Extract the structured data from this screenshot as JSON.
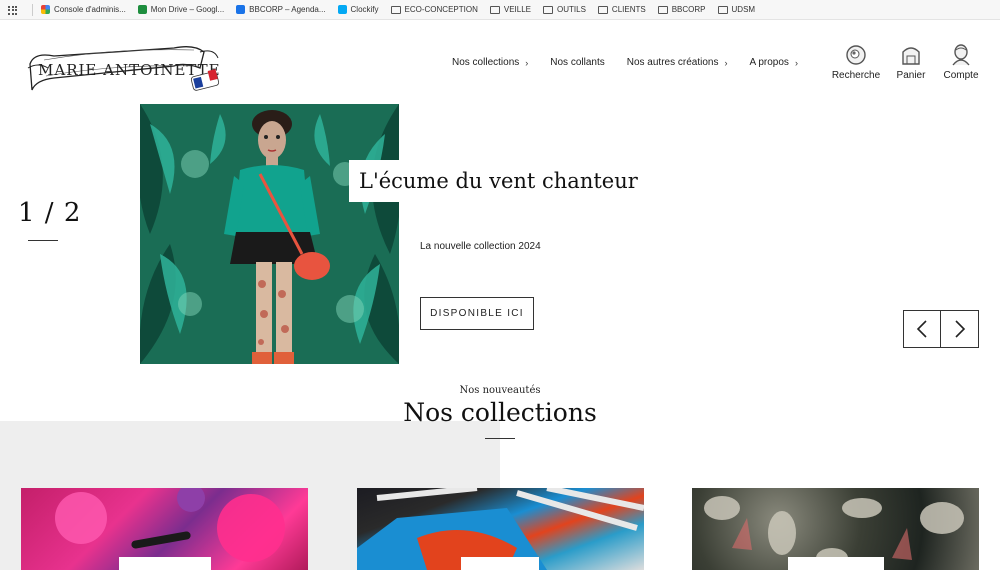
{
  "bookmarks": [
    {
      "label": "Console d'adminis...",
      "icon": "google-icon"
    },
    {
      "label": "Mon Drive – Googl...",
      "icon": "drive-icon"
    },
    {
      "label": "BBCORP – Agenda...",
      "icon": "calendar-icon"
    },
    {
      "label": "Clockify",
      "icon": "clockify-icon"
    },
    {
      "label": "ECO-CONCEPTION",
      "icon": "folder-icon"
    },
    {
      "label": "VEILLE",
      "icon": "folder-icon"
    },
    {
      "label": "OUTILS",
      "icon": "folder-icon"
    },
    {
      "label": "CLIENTS",
      "icon": "folder-icon"
    },
    {
      "label": "BBCORP",
      "icon": "folder-icon"
    },
    {
      "label": "UDSM",
      "icon": "folder-icon"
    }
  ],
  "logo": {
    "text": "MARIE ANTOINETTE"
  },
  "nav": [
    {
      "label": "Nos collections",
      "chevron": "›"
    },
    {
      "label": "Nos collants",
      "chevron": ""
    },
    {
      "label": "Nos autres créations",
      "chevron": "›"
    },
    {
      "label": "A propos",
      "chevron": "›"
    }
  ],
  "actions": {
    "search": "Recherche",
    "cart": "Panier",
    "account": "Compte"
  },
  "hero": {
    "counter": "1 / 2",
    "current_slide": 1,
    "total_slides": 2,
    "title": "L'écume du vent chanteur",
    "subtitle": "La nouvelle collection 2024",
    "cta": "DISPONIBLE ICI"
  },
  "collections": {
    "subtitle": "Nos nouveautés",
    "title": "Nos collections"
  },
  "colors": {
    "text": "#1a1a1a",
    "grey_block": "#eeeeee",
    "flag_blue": "#1b3f9c",
    "flag_red": "#d6232f"
  }
}
